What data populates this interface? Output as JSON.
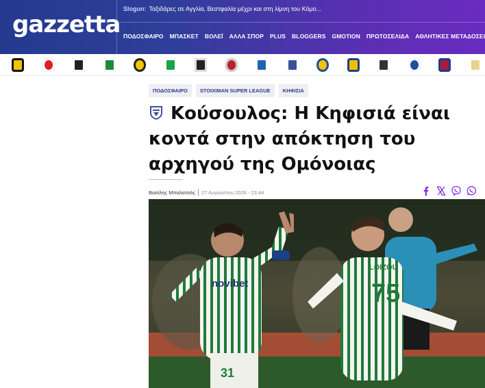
{
  "header": {
    "logo": "gazzetta",
    "slogan_label": "Slogun:",
    "slogan_text": "Ταξιδάρες σε Αγγλία, Βεστφαλία μέχρι και στη λίμνη του Κόμο...",
    "nav": [
      "ΠΟΔΟΣΦΑΙΡΟ",
      "ΜΠΑΣΚΕΤ",
      "ΒΟΛΕΪ",
      "ΑΛΛΑ ΣΠΟΡ",
      "PLUS",
      "BLOGGERS",
      "GMOTION",
      "ΠΡΩΤΟΣΕΛΙΔΑ",
      "ΑΘΛΗΤΙΚΕΣ ΜΕΤΑΔΟΣΕΙΣ"
    ]
  },
  "crests": [
    {
      "name": "aek-crest",
      "color": "#f2c200",
      "accent": "#111"
    },
    {
      "name": "olympiacos-crest",
      "color": "#d8202a",
      "accent": "#fff"
    },
    {
      "name": "paok-crest",
      "color": "#222",
      "accent": "#fff"
    },
    {
      "name": "panathinaikos-crest",
      "color": "#1e8a3c",
      "accent": "#fff"
    },
    {
      "name": "aris-crest",
      "color": "#f3c400",
      "accent": "#222"
    },
    {
      "name": "levadiakos-crest",
      "color": "#19a34a",
      "accent": "#fff"
    },
    {
      "name": "ofi-crest",
      "color": "#222",
      "accent": "#ddd"
    },
    {
      "name": "volos-crest",
      "color": "#b8202a",
      "accent": "#ccc"
    },
    {
      "name": "atromitos-crest",
      "color": "#1f63b5",
      "accent": "#fff"
    },
    {
      "name": "kifisia-crest",
      "color": "#3d4f9a",
      "accent": "#fff"
    },
    {
      "name": "asteras-crest",
      "color": "#f3c400",
      "accent": "#1f4fa0"
    },
    {
      "name": "panaitolikos-crest",
      "color": "#f0c000",
      "accent": "#1f3f8a"
    },
    {
      "name": "kalamata-crest",
      "color": "#333",
      "accent": "#fff"
    },
    {
      "name": "panserraikos-crest",
      "color": "#1f4fa0",
      "accent": "#fff"
    },
    {
      "name": "barcelona-crest",
      "color": "#a51d3a",
      "accent": "#1d3c8f"
    },
    {
      "name": "real-madrid-crest",
      "color": "#e9d28a",
      "accent": "#fff"
    }
  ],
  "tags": [
    "ΠΟΔΟΣΦΑΙΡΟ",
    "STOIXIMAN SUPER LEAGUE",
    "ΚΗΦΙΣΙΑ"
  ],
  "article": {
    "title": "Κούσουλος: Η Κηφισιά είναι κοντά στην απόκτηση του αρχηγού της Ομόνοιας",
    "author": "Βασίλης Μπαλατσός",
    "date": "27 Αυγούστου 2026 - 23:44",
    "photo_jersey_name": "LOIZOU",
    "photo_jersey_number": "75",
    "photo_shorts_number": "31",
    "photo_sponsor": "novibet"
  },
  "share_icons": [
    "facebook-icon",
    "x-icon",
    "viber-icon",
    "whatsapp-icon"
  ],
  "colors": {
    "brand_blue": "#243a8f",
    "brand_purple": "#6a2bc0",
    "share_purple": "#8a2be2",
    "tag_bg": "#eeeef3",
    "tag_text": "#2b3a8a"
  }
}
